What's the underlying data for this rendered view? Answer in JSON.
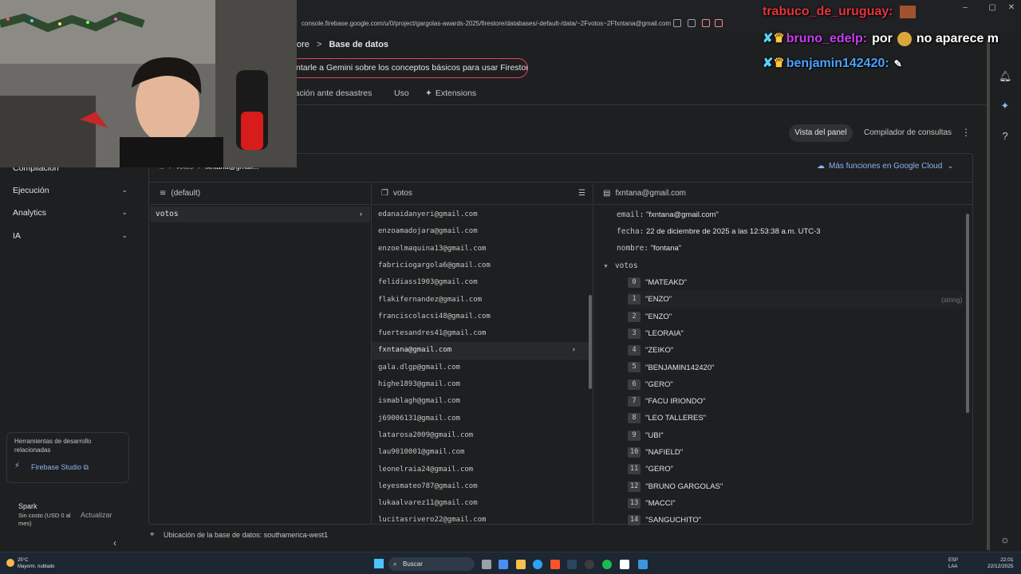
{
  "browser": {
    "url": "console.firebase.google.com/u/0/project/gargolas-awards-2025/firestore/databases/-default-/data/~2Fvotos~2Ffxntana@gmail.com"
  },
  "header": {
    "breadcrumb_prefix": "ore",
    "breadcrumb_sep": ">",
    "breadcrumb_current": "Base de datos",
    "gemini_prompt": "ntarle a Gemini sobre los conceptos básicos para usar Firestore",
    "tabs": [
      "ración ante desastres",
      "Uso",
      "Extensions"
    ]
  },
  "view_mode": {
    "panel": "Vista del panel",
    "query": "Compilador de consultas"
  },
  "left_nav": {
    "items": [
      {
        "label": "Compilación"
      },
      {
        "label": "Ejecución"
      },
      {
        "label": "Analytics"
      },
      {
        "label": "IA"
      }
    ],
    "tools_title": "Herramientas de desarrollo relacionadas",
    "studio_link": "Firebase Studio",
    "plan_name": "Spark",
    "plan_desc": "Sin costo (USD 0 al mes)",
    "plan_upgrade": "Actualizar"
  },
  "panel": {
    "path_collection": "votos",
    "path_doc": "fxntana@gmail...",
    "google_cloud_link": "Más funciones en Google Cloud",
    "col1_title": "(default)",
    "col1_item": "votos",
    "col2_title": "votos",
    "col3_title": "fxntana@gmail.com",
    "documents": [
      "edanaidanyeri@gmail.com",
      "enzoamadojara@gmail.com",
      "enzoelmaquina13@gmail.com",
      "fabriciogargola6@gmail.com",
      "felidiass1903@gmail.com",
      "flakifernandez@gmail.com",
      "franciscolacsi48@gmail.com",
      "fuertesandres41@gmail.com",
      "fxntana@gmail.com",
      "gala.dlgp@gmail.com",
      "highe1893@gmail.com",
      "ismablagh@gmail.com",
      "j69006131@gmail.com",
      "latarosa2009@gmail.com",
      "lau9010001@gmail.com",
      "leonelraia24@gmail.com",
      "leyesmateo787@gmail.com",
      "lukaalvarez11@gmail.com",
      "lucitasrivero22@gmail.com"
    ],
    "selected_document": "fxntana@gmail.com",
    "fields": {
      "email_key": "email:",
      "email_val": "\"fxntana@gmail.com\"",
      "fecha_key": "fecha:",
      "fecha_val": "22 de diciembre de 2025 a las 12:53:38 a.m. UTC-3",
      "nombre_key": "nombre:",
      "nombre_val": "\"fontana\"",
      "votos_key": "votos"
    },
    "votes": [
      {
        "i": "0",
        "v": "\"MATEAKD\""
      },
      {
        "i": "1",
        "v": "\"ENZO\""
      },
      {
        "i": "2",
        "v": "\"ENZO\""
      },
      {
        "i": "3",
        "v": "\"LEORAIA\""
      },
      {
        "i": "4",
        "v": "\"ZEIKO\""
      },
      {
        "i": "5",
        "v": "\"BENJAMIN142420\""
      },
      {
        "i": "6",
        "v": "\"GERO\""
      },
      {
        "i": "7",
        "v": "\"FACU IRIONDO\""
      },
      {
        "i": "8",
        "v": "\"LEO TALLERES\""
      },
      {
        "i": "9",
        "v": "\"UBI\""
      },
      {
        "i": "10",
        "v": "\"NAFIELD\""
      },
      {
        "i": "11",
        "v": "\"GERO\""
      },
      {
        "i": "12",
        "v": "\"BRUNO GARGOLAS\""
      },
      {
        "i": "13",
        "v": "\"MACCI\""
      },
      {
        "i": "14",
        "v": "\"SANGUCHITO\""
      }
    ],
    "vote_type_hint": "(string)",
    "db_location": "Ubicación de la base de datos: southamerica-west1"
  },
  "chat": {
    "line1_user": "trabuco_de_uruguay:",
    "line2_user": "bruno_edelp:",
    "line2_text": "por",
    "line2_text2": "no aparece m",
    "line3_user": "benjamin142420:",
    "colors": {
      "user1": "#e8343b",
      "user2": "#c73df5",
      "user3": "#4aa3ff"
    }
  },
  "taskbar": {
    "temp": "25°C",
    "weather": "Mayorm. nublado",
    "search": "Buscar",
    "lang1": "ESP",
    "lang2": "LAA",
    "time": "22:01",
    "date": "22/12/2025"
  }
}
